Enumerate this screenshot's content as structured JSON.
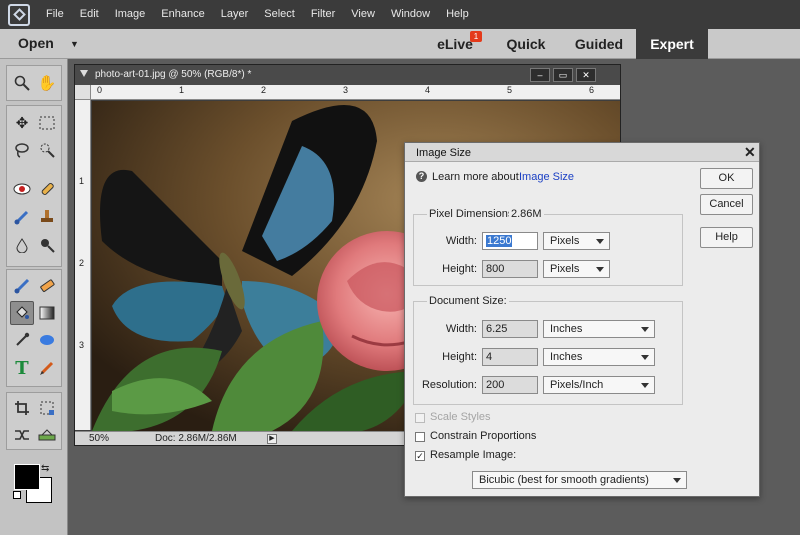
{
  "menubar": {
    "logo_icon": "elements-logo-icon",
    "items": [
      "File",
      "Edit",
      "Image",
      "Enhance",
      "Layer",
      "Select",
      "Filter",
      "View",
      "Window",
      "Help"
    ]
  },
  "modebar": {
    "open_label": "Open",
    "elive_label": "eLive",
    "elive_badge": "1",
    "quick_label": "Quick",
    "guided_label": "Guided",
    "expert_label": "Expert"
  },
  "document": {
    "title": "photo-art-01.jpg @ 50% (RGB/8*) *",
    "ruler_h": [
      "0",
      "1",
      "2",
      "3",
      "4",
      "5",
      "6"
    ],
    "ruler_v": [
      "1",
      "2",
      "3"
    ],
    "zoom": "50%",
    "doc_info": "Doc: 2.86M/2.86M"
  },
  "dialog": {
    "title": "Image Size",
    "learn_text": "Learn more about:",
    "learn_link": "Image Size",
    "ok_label": "OK",
    "cancel_label": "Cancel",
    "help_label": "Help",
    "pixel_dimensions_label": "Pixel Dimensions:",
    "pixel_dimensions_value": "2.86M",
    "px_width_label": "Width:",
    "px_width_value": "1250",
    "px_width_unit": "Pixels",
    "px_height_label": "Height:",
    "px_height_value": "800",
    "px_height_unit": "Pixels",
    "document_size_label": "Document Size:",
    "doc_width_label": "Width:",
    "doc_width_value": "6.25",
    "doc_width_unit": "Inches",
    "doc_height_label": "Height:",
    "doc_height_value": "4",
    "doc_height_unit": "Inches",
    "resolution_label": "Resolution:",
    "resolution_value": "200",
    "resolution_unit": "Pixels/Inch",
    "scale_styles_label": "Scale Styles",
    "scale_styles_checked": false,
    "constrain_label": "Constrain Proportions",
    "constrain_checked": false,
    "resample_label": "Resample Image:",
    "resample_checked": true,
    "resample_method": "Bicubic (best for smooth gradients)"
  },
  "colors": {
    "menubar_bg": "#3b3b3b",
    "expert_tab_bg": "#3b3b3b",
    "link": "#1a3fc4",
    "selection": "#3b79d0"
  }
}
